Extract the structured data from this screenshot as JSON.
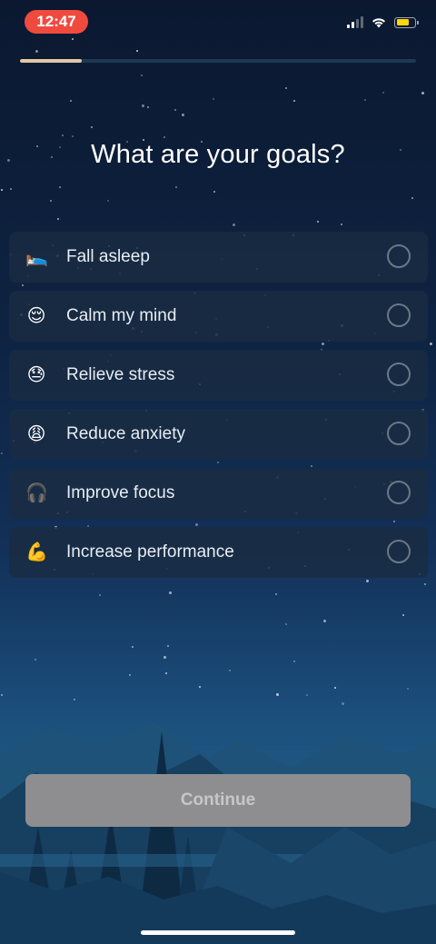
{
  "status_bar": {
    "time": "12:47",
    "time_pill_color": "#f04a3f",
    "battery_color": "#ffd60a"
  },
  "progress": {
    "fraction": 0.155,
    "fill_color": "#e2c8a6"
  },
  "title": "What are your goals?",
  "goals": [
    {
      "emoji": "🛌",
      "label": "Fall asleep",
      "selected": false,
      "icon": "bed-icon"
    },
    {
      "emoji": "😌",
      "label": "Calm my mind",
      "selected": false,
      "icon": "relieved-face-icon"
    },
    {
      "emoji": "😓",
      "label": "Relieve stress",
      "selected": false,
      "icon": "sweat-face-icon"
    },
    {
      "emoji": "😩",
      "label": "Reduce anxiety",
      "selected": false,
      "icon": "weary-face-icon"
    },
    {
      "emoji": "🎧",
      "label": "Improve focus",
      "selected": false,
      "icon": "headphones-icon"
    },
    {
      "emoji": "💪",
      "label": "Increase performance",
      "selected": false,
      "icon": "flexed-biceps-icon"
    }
  ],
  "continue_button": {
    "label": "Continue",
    "enabled": false,
    "color": "#8e8e90"
  }
}
